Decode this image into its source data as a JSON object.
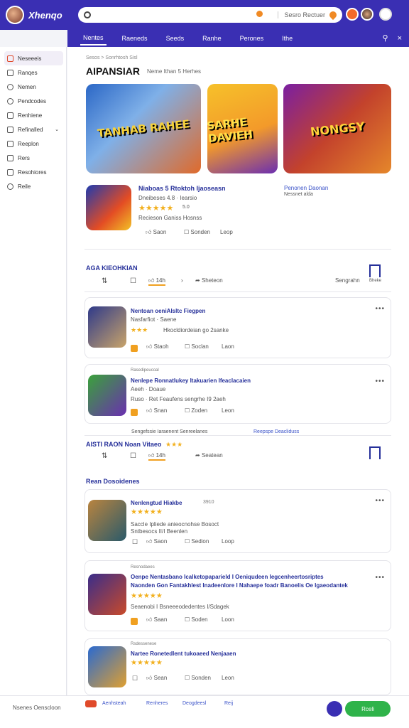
{
  "app": {
    "brand": "Xhenqo"
  },
  "search": {
    "placeholder": "",
    "hint": "Sesro Rectuer"
  },
  "nav": {
    "tabs": [
      "Nentes",
      "Raeneds",
      "Seeds",
      "Ranhe",
      "Perones",
      "Ithe"
    ],
    "active": 0
  },
  "sidebar": {
    "items": [
      "Neseeeis",
      "Ranqes",
      "Nemen",
      "Pendcodes",
      "Renhiene",
      "Refinalled",
      "Reeplon",
      "Rers",
      "Resohiores",
      "Reile"
    ],
    "active": 0
  },
  "page": {
    "breadcrumb": "Sesos > Sonrhtosh Sisl",
    "title": "AIPANSIAR",
    "subtitle": "Neme Ithan 5 Herhes"
  },
  "banners": [
    {
      "text": "TANHAB RAHEE",
      "colors": [
        "#2b67c6",
        "#e06a2a"
      ]
    },
    {
      "text": "SARHE DAVIEH",
      "colors": [
        "#f6c12a",
        "#6b2fb0"
      ]
    },
    {
      "text": "NONGSY",
      "colors": [
        "#7a1fa2",
        "#e5872b"
      ]
    }
  ],
  "featured": {
    "title": "Niaboas 5 Rtoktoh Ijaoseasn",
    "meta": "Dneibeses 4.8 · Iearsio",
    "rating_note": "5.0",
    "desc": "Recieson Ganiss Hosnss",
    "side_link": "Penonen Daonan",
    "side_sub": "Nessnet alda",
    "like": "Saon",
    "save": "Sonden",
    "share": "Leop"
  },
  "section1": {
    "title": "AGA KIEOHKIAN",
    "count": "14h",
    "share": "Sheteon",
    "right": "Sengrahn",
    "right2": "Bheke"
  },
  "cards1": [
    {
      "title": "Nentoan oeniAlsltc Fiegpen",
      "meta": "Nasfarfiot · Saene",
      "desc": "Hkocldiordeian go 2sanke",
      "like": "Staoh",
      "save": "Soclan",
      "share": "Laon",
      "colors": [
        "#2f3a8a",
        "#c9a46a"
      ]
    },
    {
      "title": "Nenlepe Ronnatlukey Itakuarien Ifeaclacaien",
      "pre": "Rasedipeucoal",
      "meta": "Aeeh · Doaue",
      "desc": "Ruso · Ret Feaufens sengrhe I9 2aeh",
      "like": "Snan",
      "save": "Zoden",
      "share": "Leon",
      "colors": [
        "#3aa23a",
        "#6a2fb0"
      ]
    }
  ],
  "links_row": {
    "left": "Sengefssie Iaraenent Senreelanes",
    "right": "Reepspe Deacliduss"
  },
  "section2": {
    "title": "AISTI RAON Noan Vitaeo",
    "count": "14h",
    "share": "Seatean"
  },
  "section3": {
    "title": "Rean Dosoidenes"
  },
  "cards2": [
    {
      "title": "Nenlengtud Hiakbe",
      "meta": "3910",
      "desc1": "Saccle Ipliede anieocnohse Bosoct",
      "desc2": "Sntbesocs II/I Beenlen",
      "like": "Saon",
      "save": "Sedion",
      "share": "Loop",
      "colors": [
        "#b9843f",
        "#2a5a6a"
      ]
    },
    {
      "title": "Oenpe Nentasbano Icalketopaparield I Oeniqudeen Iegcenheertosriptes",
      "pre": "Resnodaees",
      "title2": "Naonden Gon Fantakhlest Inadeenlore I Nahaepe foadr Banoelis Oe Igaeodantek",
      "desc": "Seaenobi I Bsneeeodedentes I/Sdagek",
      "like": "Saan",
      "save": "Soden",
      "share": "Loon",
      "colors": [
        "#3a2d8a",
        "#c94a2a"
      ]
    },
    {
      "title": "Nartee Ronetedlent tukoaeed Nenjaaen",
      "pre": "Rsdessenese",
      "like": "Sean",
      "save": "Sonden",
      "share": "Leon",
      "colors": [
        "#2a6ad0",
        "#e0a030"
      ]
    }
  ],
  "bottom": {
    "left": "Nsenes Oenscloon",
    "badge": "",
    "link1": "Aenhsteah",
    "link2": "Renheres",
    "link3": "Deogdeesl",
    "link4": "Reij",
    "cta": "Rceli"
  }
}
